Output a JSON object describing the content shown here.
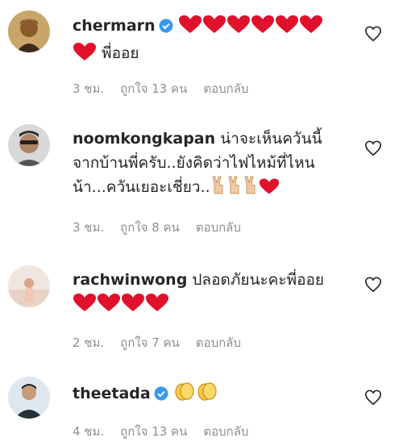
{
  "comments": [
    {
      "username": "chermarn",
      "verified": true,
      "text": "พี่ออย",
      "emoji_line1": "heart x6",
      "time": "3 ชม.",
      "likes": "ถูกใจ 13 คน",
      "reply": "ตอบกลับ"
    },
    {
      "username": "noomkongkapan",
      "verified": false,
      "text_line1": "น่าจะเห็นควันนี้",
      "text_line2": "จากบ้านพี่ครับ..ยังคิดว่าไฟไหม้ที่ไหน",
      "text_line3": "น้า...ควันเยอะเชี่ยว..",
      "time": "3 ชม.",
      "likes": "ถูกใจ 8 คน",
      "reply": "ตอบกลับ"
    },
    {
      "username": "rachwinwong",
      "verified": false,
      "text": "ปลอดภัยนะคะพี่ออย",
      "time": "2 ชม.",
      "likes": "ถูกใจ 7 คน",
      "reply": "ตอบกลับ"
    },
    {
      "username": "theetada",
      "verified": true,
      "time": "4 ชม.",
      "likes": "ถูกใจ 13 คน",
      "reply": "ตอบกลับ"
    }
  ],
  "colors": {
    "heart": "#e0112b",
    "verified": "#3897f0",
    "meta": "#8e8e8e",
    "text": "#262626"
  }
}
